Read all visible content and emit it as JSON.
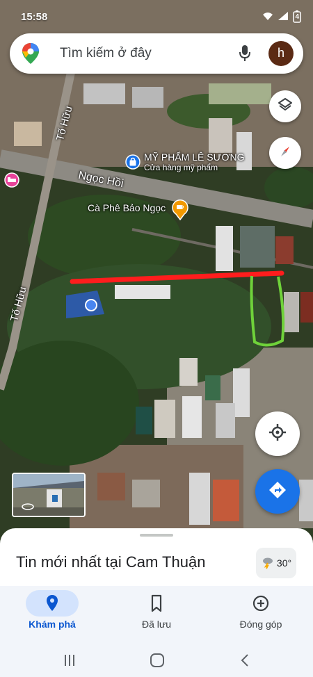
{
  "status_bar": {
    "time": "15:58",
    "battery": "4"
  },
  "search": {
    "placeholder": "Tìm kiếm ở đây",
    "avatar_letter": "h"
  },
  "map_labels": {
    "street_1": "Tố Hữu",
    "street_2": "Tố Hữu",
    "street_3": "Ngọc Hồi",
    "poi_1_name": "MỸ PHẨM LÊ SƯƠNG",
    "poi_1_sub": "Cửa hàng mỹ phẩm",
    "poi_2_name": "Cà Phê Bảo Ngọc"
  },
  "sheet": {
    "title": "Tin mới nhất tại Cam Thuận",
    "temperature": "30°"
  },
  "nav": {
    "items": [
      {
        "label": "Khám phá"
      },
      {
        "label": "Đã lưu"
      },
      {
        "label": "Đóng góp"
      }
    ]
  },
  "colors": {
    "accent": "#1a73e8",
    "annotation_red": "#ff1d1d",
    "annotation_green": "#6fd23a"
  }
}
